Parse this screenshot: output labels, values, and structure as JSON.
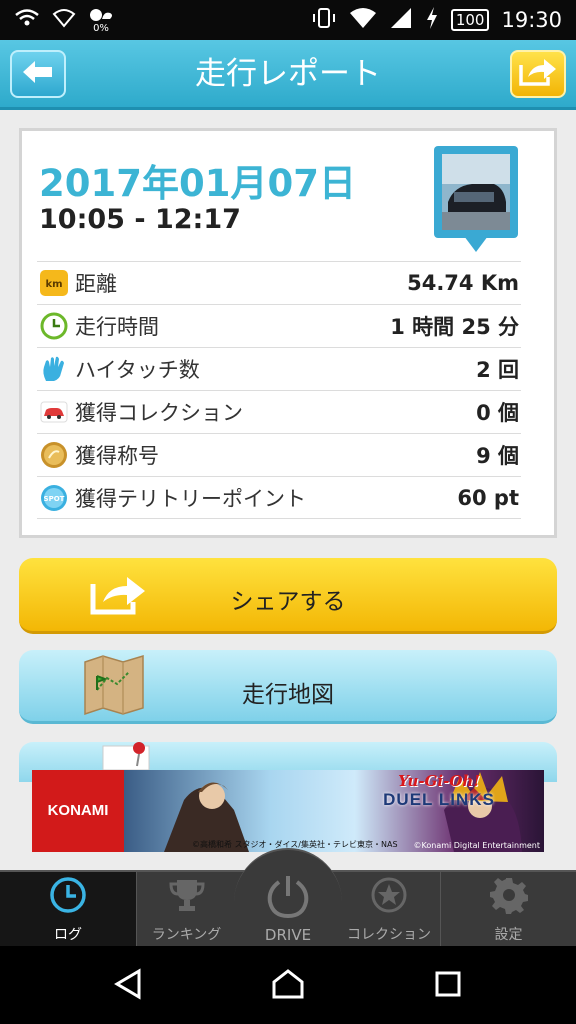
{
  "status_bar": {
    "data_percent": "0%",
    "battery": "100",
    "time": "19:30"
  },
  "header": {
    "title": "走行レポート"
  },
  "report": {
    "date": "2017年01月07日",
    "time_range": "10:05 - 12:17",
    "rows": [
      {
        "icon": "km-icon",
        "label": "距離",
        "value": "54.74 Km"
      },
      {
        "icon": "clock-icon",
        "label": "走行時間",
        "value": "1 時間 25 分"
      },
      {
        "icon": "hi-touch-icon",
        "label": "ハイタッチ数",
        "value": "2 回"
      },
      {
        "icon": "car-icon",
        "label": "獲得コレクション",
        "value": "0 個"
      },
      {
        "icon": "medal-icon",
        "label": "獲得称号",
        "value": "9 個"
      },
      {
        "icon": "spot-icon",
        "label": "獲得テリトリーポイント",
        "value": "60 pt"
      }
    ],
    "km_badge": "km",
    "spot_badge": "SPOT"
  },
  "actions": {
    "share_label": "シェアする",
    "map_label": "走行地図"
  },
  "ad": {
    "brand": "KONAMI",
    "game_title_top": "Yu-Gi-Oh!",
    "game_title": "DUEL LINKS",
    "credit_left": "©高橋和希 スタジオ・ダイス/集英社・テレビ東京・NAS",
    "credit_right": "©Konami Digital Entertainment"
  },
  "tabs": [
    {
      "label": "ログ"
    },
    {
      "label": "ランキング"
    },
    {
      "label": "DRIVE"
    },
    {
      "label": "コレクション"
    },
    {
      "label": "設定"
    }
  ],
  "colors": {
    "accent_blue": "#3cb4d4",
    "share_yellow": "#f3b705",
    "header_blue": "#2eaacb"
  }
}
